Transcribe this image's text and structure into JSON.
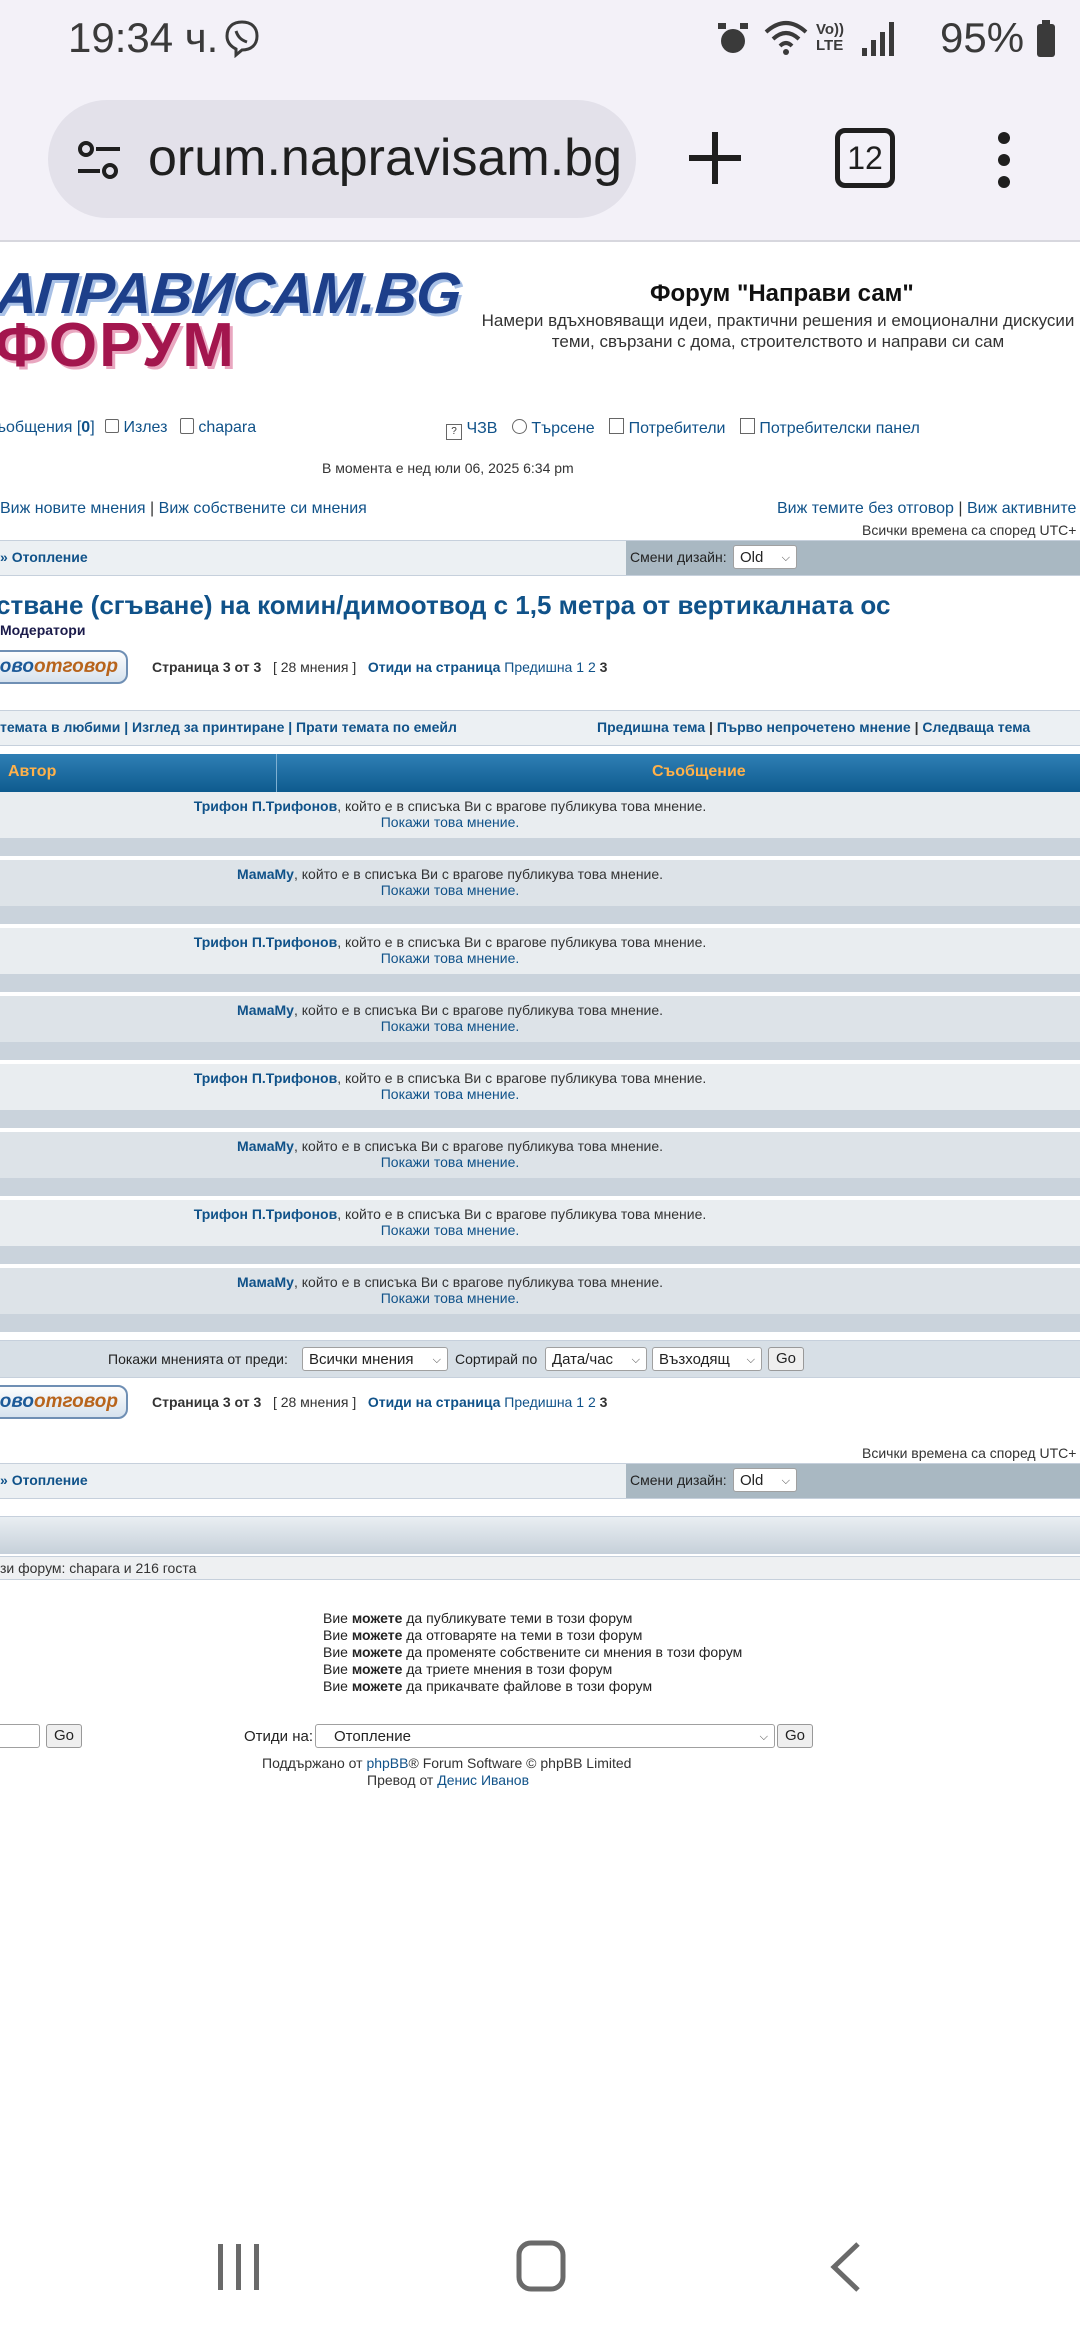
{
  "status_bar": {
    "time": "19:34 ч.",
    "battery": "95%",
    "icons": [
      "viber-icon",
      "alarm-icon",
      "wifi-icon",
      "volte-icon",
      "signal-icon",
      "battery-icon"
    ],
    "volte": "Vo)) LTE"
  },
  "browser": {
    "url": "orum.napravisam.bg",
    "tab_count": "12"
  },
  "header": {
    "logo_line1": "АПРАВИСАМ.BG",
    "logo_line2": "ФОРУМ",
    "title": "Форум \"Направи сам\"",
    "description": "Намери вдъхновяващи идеи, практични решения и емоционални дискусии теми, свързани с дома, строителството и направи си сам"
  },
  "nav": {
    "messages_label": "ъобщения [",
    "messages_count": "0",
    "messages_close": "]",
    "logout": "Излез",
    "username": "chapara",
    "faq": "ЧЗВ",
    "search": "Търсене",
    "members": "Потребители",
    "ucp": "Потребителски панел"
  },
  "current_time": "В момента е нед юли 06, 2025 6:34 pm",
  "links_left": {
    "new_posts": "Виж новите мнения",
    "sep": "|",
    "own_posts": "Виж собствените си мнения"
  },
  "links_right": {
    "unanswered": "Виж темите без отговор",
    "sep": "|",
    "active": "Виж активните"
  },
  "timezone": "Всички времена са според UTC+",
  "breadcrumb": {
    "prefix": "»",
    "forum": "Отопление"
  },
  "style_switch": {
    "label": "Смени дизайн:",
    "value": "Old"
  },
  "topic": {
    "title": "стване (сгъване) на комин/димоотвод с 1,5 метра от вертикалната ос",
    "moderators": "Модератори"
  },
  "reply_button": {
    "part1": "ново",
    "part2": "отговор"
  },
  "pagination": {
    "page_label": "Страница",
    "current": "3",
    "of": "от",
    "total": "3",
    "count_text": "[ 28 мнения ]",
    "goto": "Отиди на страница",
    "prev": "Предишна",
    "p1": "1",
    "p2": "2",
    "p3": "3"
  },
  "topic_actions": {
    "left": "темата в любими | Изглед за принтиране | Прати темата по емейл",
    "prev_topic": "Предишна тема",
    "first_unread": "Първо непрочетено мнение",
    "next_topic": "Следваща тема",
    "sep": "|"
  },
  "table_header": {
    "author": "Автор",
    "message": "Съобщение"
  },
  "foe_text": ", който е в списъка Ви с врагове публикува това мнение.",
  "show_post": "Покажи това мнение.",
  "posts": [
    {
      "author": "Трифон П.Трифонов"
    },
    {
      "author": "МамаМу"
    },
    {
      "author": "Трифон П.Трифонов"
    },
    {
      "author": "МамаМу"
    },
    {
      "author": "Трифон П.Трифонов"
    },
    {
      "author": "МамаМу"
    },
    {
      "author": "Трифон П.Трифонов"
    },
    {
      "author": "МамаМу"
    }
  ],
  "sort_bar": {
    "show_from": "Покажи мненията от преди:",
    "show_value": "Всички мнения",
    "sort_by": "Сортирай по",
    "sort_value": "Дата/час",
    "order_value": "Възходящ",
    "go": "Go"
  },
  "whos_online": "зи форум: chapara и 216 госта",
  "permissions": [
    {
      "pre": "Вие",
      "bold": "можете",
      "post": "да публикувате теми в този форум"
    },
    {
      "pre": "Вие",
      "bold": "можете",
      "post": "да отговаряте на теми в този форум"
    },
    {
      "pre": "Вие",
      "bold": "можете",
      "post": "да променяте собствените си мнения в този форум"
    },
    {
      "pre": "Вие",
      "bold": "можете",
      "post": "да триете мнения в този форум"
    },
    {
      "pre": "Вие",
      "bold": "можете",
      "post": "да прикачвате файлове в този форум"
    }
  ],
  "jump": {
    "go": "Go",
    "label": "Отиди на:",
    "value": "Отопление"
  },
  "footer": {
    "powered_pre": "Поддържано от",
    "phpbb": "phpBB",
    "powered_post": "® Forum Software © phpBB Limited",
    "translation_pre": "Превод от",
    "translator": "Денис Иванов"
  }
}
